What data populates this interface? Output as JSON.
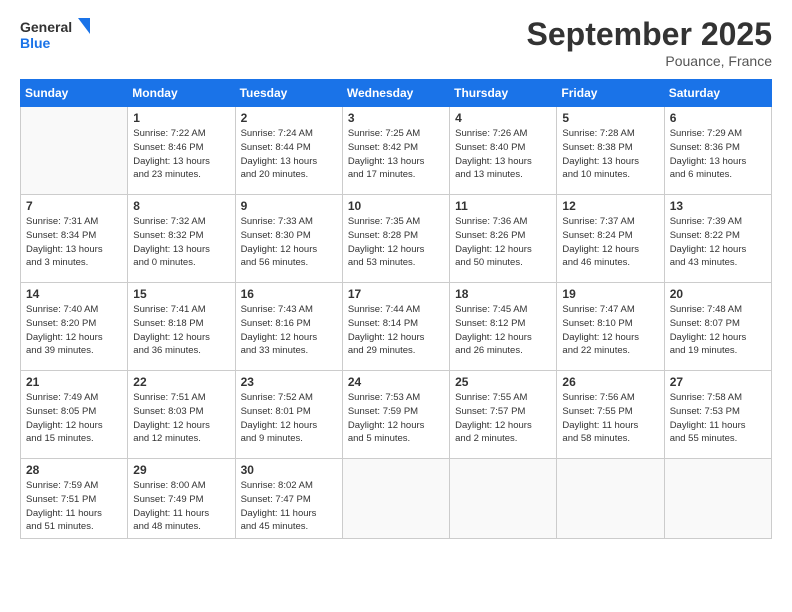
{
  "header": {
    "logo_line1": "General",
    "logo_line2": "Blue",
    "month_title": "September 2025",
    "subtitle": "Pouance, France"
  },
  "weekdays": [
    "Sunday",
    "Monday",
    "Tuesday",
    "Wednesday",
    "Thursday",
    "Friday",
    "Saturday"
  ],
  "weeks": [
    [
      {
        "day": "",
        "info": ""
      },
      {
        "day": "1",
        "info": "Sunrise: 7:22 AM\nSunset: 8:46 PM\nDaylight: 13 hours\nand 23 minutes."
      },
      {
        "day": "2",
        "info": "Sunrise: 7:24 AM\nSunset: 8:44 PM\nDaylight: 13 hours\nand 20 minutes."
      },
      {
        "day": "3",
        "info": "Sunrise: 7:25 AM\nSunset: 8:42 PM\nDaylight: 13 hours\nand 17 minutes."
      },
      {
        "day": "4",
        "info": "Sunrise: 7:26 AM\nSunset: 8:40 PM\nDaylight: 13 hours\nand 13 minutes."
      },
      {
        "day": "5",
        "info": "Sunrise: 7:28 AM\nSunset: 8:38 PM\nDaylight: 13 hours\nand 10 minutes."
      },
      {
        "day": "6",
        "info": "Sunrise: 7:29 AM\nSunset: 8:36 PM\nDaylight: 13 hours\nand 6 minutes."
      }
    ],
    [
      {
        "day": "7",
        "info": "Sunrise: 7:31 AM\nSunset: 8:34 PM\nDaylight: 13 hours\nand 3 minutes."
      },
      {
        "day": "8",
        "info": "Sunrise: 7:32 AM\nSunset: 8:32 PM\nDaylight: 13 hours\nand 0 minutes."
      },
      {
        "day": "9",
        "info": "Sunrise: 7:33 AM\nSunset: 8:30 PM\nDaylight: 12 hours\nand 56 minutes."
      },
      {
        "day": "10",
        "info": "Sunrise: 7:35 AM\nSunset: 8:28 PM\nDaylight: 12 hours\nand 53 minutes."
      },
      {
        "day": "11",
        "info": "Sunrise: 7:36 AM\nSunset: 8:26 PM\nDaylight: 12 hours\nand 50 minutes."
      },
      {
        "day": "12",
        "info": "Sunrise: 7:37 AM\nSunset: 8:24 PM\nDaylight: 12 hours\nand 46 minutes."
      },
      {
        "day": "13",
        "info": "Sunrise: 7:39 AM\nSunset: 8:22 PM\nDaylight: 12 hours\nand 43 minutes."
      }
    ],
    [
      {
        "day": "14",
        "info": "Sunrise: 7:40 AM\nSunset: 8:20 PM\nDaylight: 12 hours\nand 39 minutes."
      },
      {
        "day": "15",
        "info": "Sunrise: 7:41 AM\nSunset: 8:18 PM\nDaylight: 12 hours\nand 36 minutes."
      },
      {
        "day": "16",
        "info": "Sunrise: 7:43 AM\nSunset: 8:16 PM\nDaylight: 12 hours\nand 33 minutes."
      },
      {
        "day": "17",
        "info": "Sunrise: 7:44 AM\nSunset: 8:14 PM\nDaylight: 12 hours\nand 29 minutes."
      },
      {
        "day": "18",
        "info": "Sunrise: 7:45 AM\nSunset: 8:12 PM\nDaylight: 12 hours\nand 26 minutes."
      },
      {
        "day": "19",
        "info": "Sunrise: 7:47 AM\nSunset: 8:10 PM\nDaylight: 12 hours\nand 22 minutes."
      },
      {
        "day": "20",
        "info": "Sunrise: 7:48 AM\nSunset: 8:07 PM\nDaylight: 12 hours\nand 19 minutes."
      }
    ],
    [
      {
        "day": "21",
        "info": "Sunrise: 7:49 AM\nSunset: 8:05 PM\nDaylight: 12 hours\nand 15 minutes."
      },
      {
        "day": "22",
        "info": "Sunrise: 7:51 AM\nSunset: 8:03 PM\nDaylight: 12 hours\nand 12 minutes."
      },
      {
        "day": "23",
        "info": "Sunrise: 7:52 AM\nSunset: 8:01 PM\nDaylight: 12 hours\nand 9 minutes."
      },
      {
        "day": "24",
        "info": "Sunrise: 7:53 AM\nSunset: 7:59 PM\nDaylight: 12 hours\nand 5 minutes."
      },
      {
        "day": "25",
        "info": "Sunrise: 7:55 AM\nSunset: 7:57 PM\nDaylight: 12 hours\nand 2 minutes."
      },
      {
        "day": "26",
        "info": "Sunrise: 7:56 AM\nSunset: 7:55 PM\nDaylight: 11 hours\nand 58 minutes."
      },
      {
        "day": "27",
        "info": "Sunrise: 7:58 AM\nSunset: 7:53 PM\nDaylight: 11 hours\nand 55 minutes."
      }
    ],
    [
      {
        "day": "28",
        "info": "Sunrise: 7:59 AM\nSunset: 7:51 PM\nDaylight: 11 hours\nand 51 minutes."
      },
      {
        "day": "29",
        "info": "Sunrise: 8:00 AM\nSunset: 7:49 PM\nDaylight: 11 hours\nand 48 minutes."
      },
      {
        "day": "30",
        "info": "Sunrise: 8:02 AM\nSunset: 7:47 PM\nDaylight: 11 hours\nand 45 minutes."
      },
      {
        "day": "",
        "info": ""
      },
      {
        "day": "",
        "info": ""
      },
      {
        "day": "",
        "info": ""
      },
      {
        "day": "",
        "info": ""
      }
    ]
  ]
}
